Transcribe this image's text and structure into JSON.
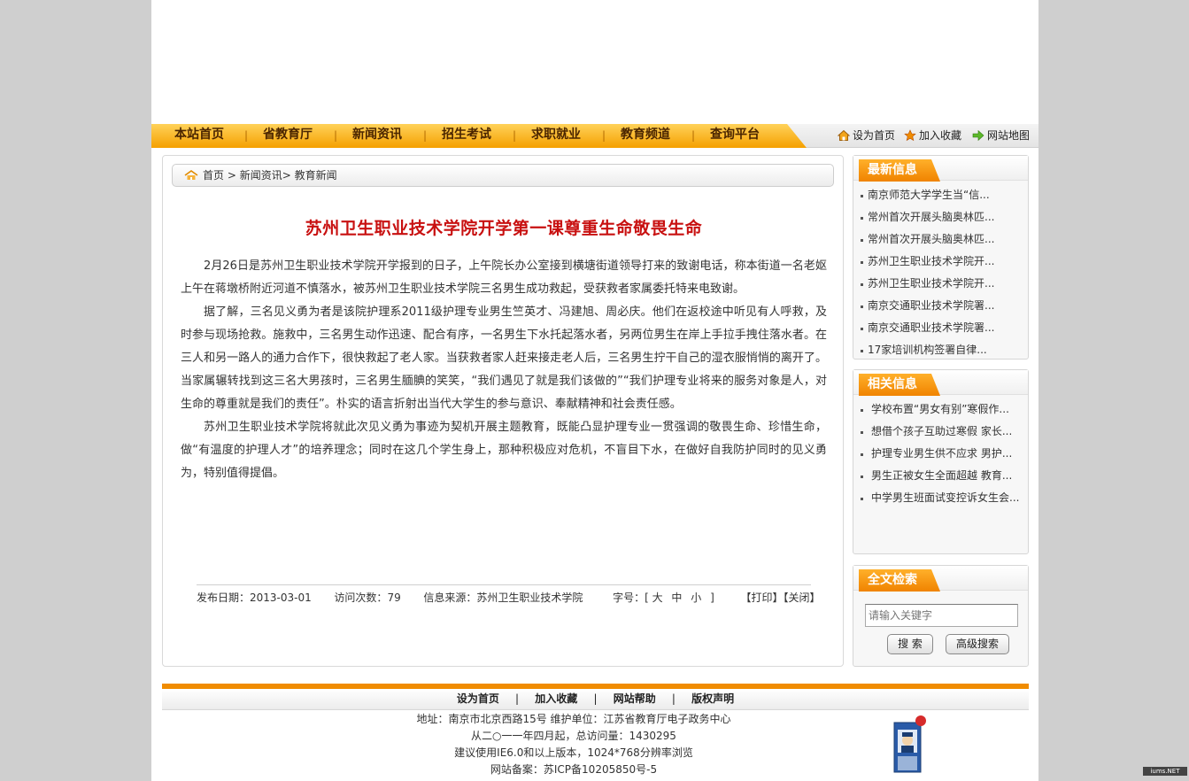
{
  "nav": {
    "items": [
      "本站首页",
      "省教育厅",
      "新闻资讯",
      "招生考试",
      "求职就业",
      "教育频道",
      "查询平台"
    ],
    "separator": "|",
    "tools": [
      "设为首页",
      "加入收藏",
      "网站地图"
    ]
  },
  "breadcrumb": {
    "home": "首页",
    "sep1": ">",
    "section": "新闻资讯>",
    "current": "教育新闻"
  },
  "article": {
    "title": "苏州卫生职业技术学院开学第一课尊重生命敬畏生命",
    "paragraphs": [
      "2月26日是苏州卫生职业技术学院开学报到的日子，上午院长办公室接到横塘街道领导打来的致谢电话，称本街道一名老妪上午在蒋墩桥附近河道不慎落水，被苏州卫生职业技术学院三名男生成功救起，受获救者家属委托特来电致谢。",
      "据了解，三名见义勇为者是该院护理系2011级护理专业男生竺英才、冯建旭、周必庆。他们在返校途中听见有人呼救，及时参与现场抢救。施救中，三名男生动作迅速、配合有序，一名男生下水托起落水者，另两位男生在岸上手拉手拽住落水者。在三人和另一路人的通力合作下，很快救起了老人家。当获救者家人赶来接走老人后，三名男生拧干自己的湿衣服悄悄的离开了。当家属辗转找到这三名大男孩时，三名男生腼腆的笑笑，“我们遇见了就是我们该做的”“我们护理专业将来的服务对象是人，对生命的尊重就是我们的责任”。朴实的语言折射出当代大学生的参与意识、奉献精神和社会责任感。",
      "苏州卫生职业技术学院将就此次见义勇为事迹为契机开展主题教育，既能凸显护理专业一贯强调的敬畏生命、珍惜生命，做“有温度的护理人才”的培养理念；同时在这几个学生身上，那种积极应对危机，不盲目下水，在做好自我防护同时的见义勇为，特别值得提倡。"
    ],
    "publish_label": "发布日期：",
    "publish_date": "2013-03-01",
    "visits_label": "访问次数：",
    "visits": "79",
    "source_label": "信息来源：",
    "source": "苏州卫生职业技术学院",
    "font_label": "字号：[",
    "font_large": "大",
    "font_medium": "中",
    "font_small": "小",
    "font_close": "]",
    "print": "【打印】",
    "close": "【关闭】"
  },
  "sidebar": {
    "latest_title": "最新信息",
    "latest": [
      "南京师范大学学生当“信...",
      "常州首次开展头脑奥林匹...",
      "常州首次开展头脑奥林匹...",
      "苏州卫生职业技术学院开...",
      "苏州卫生职业技术学院开...",
      "南京交通职业技术学院署...",
      "南京交通职业技术学院署...",
      "17家培训机构签署自律..."
    ],
    "related_title": "相关信息",
    "related": [
      "学校布置“男女有别”寒假作...",
      "想借个孩子互助过寒假 家长...",
      "护理专业男生供不应求 男护...",
      "男生正被女生全面超越 教育...",
      "中学男生班面试变控诉女生会..."
    ],
    "search_title": "全文检索",
    "search_placeholder": "请输入关键字",
    "search_button": "搜 索",
    "advanced_button": "高级搜索"
  },
  "footer": {
    "links": [
      "设为首页",
      "加入收藏",
      "网站帮助",
      "版权声明"
    ],
    "separator": "|",
    "lines": [
      "地址：南京市北京西路15号 维护单位：江苏省教育厅电子政务中心",
      "从二○一一年四月起，总访问量：1430295",
      "建议使用IE6.0和以上版本，1024*768分辨率浏览",
      "网站备案：苏ICP备10205850号-5"
    ]
  },
  "watermark": "iums.NET",
  "colors": {
    "accent_orange": "#f08c00",
    "title_red": "#c81010"
  }
}
